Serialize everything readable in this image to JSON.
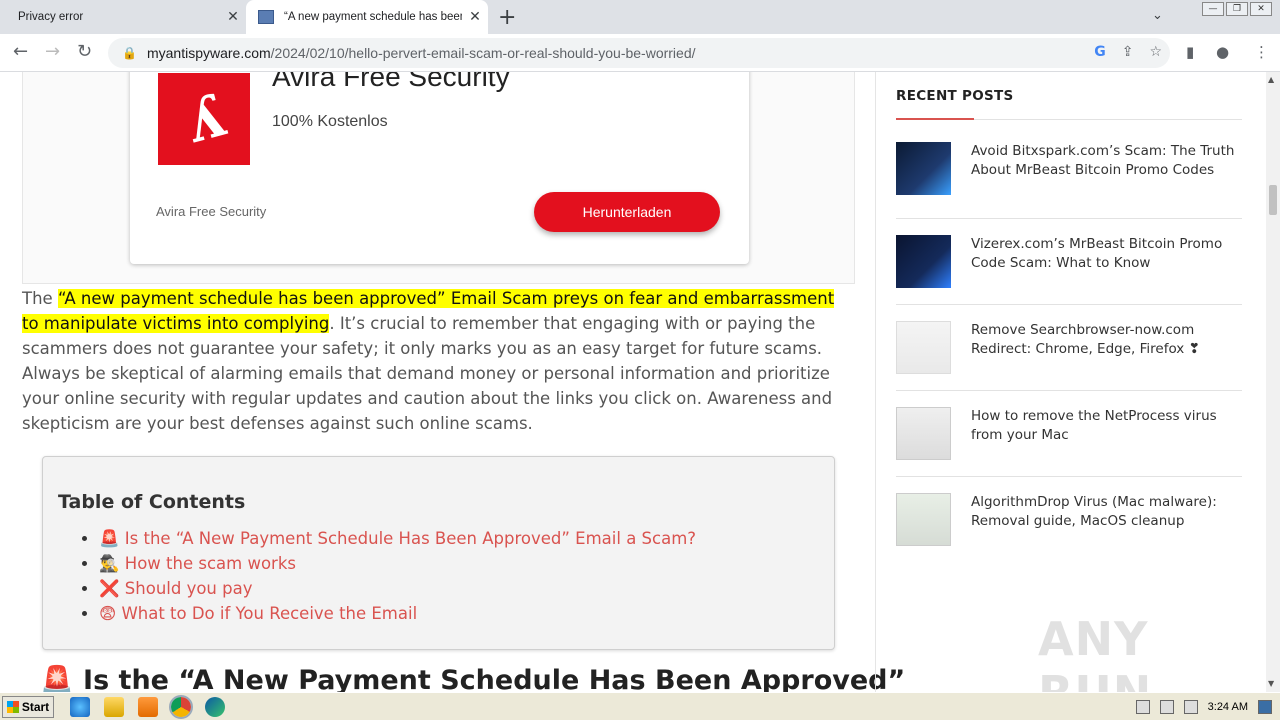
{
  "tabs": [
    {
      "title": "Privacy error",
      "active": false
    },
    {
      "title": "“A new payment schedule has been approved”",
      "active": true
    }
  ],
  "window_buttons": [
    "—",
    "❐",
    "✕"
  ],
  "address": {
    "domain": "myantispyware.com",
    "path": "/2024/02/10/hello-pervert-email-scam-or-real-should-you-be-worried/"
  },
  "ad": {
    "title": "Avira Free Security",
    "subtitle": "100% Kostenlos",
    "brand": "Avira Free Security",
    "button": "Herunterladen",
    "logo_color": "#e3101e"
  },
  "article": {
    "intro": "The ",
    "highlight": "“A new payment schedule has been approved” Email Scam preys on fear and embarrassment to manipulate victims into complying",
    "body": ". It’s crucial to remember that engaging with or paying the scammers does not guarantee your safety; it only marks you as an easy target for future scams. Always be skeptical of alarming emails that demand money or personal information and prioritize your online security with regular updates and caution about the links you click on. Awareness and skepticism are your best defenses against such online scams."
  },
  "toc": {
    "title": "Table of Contents",
    "items": [
      "🚨 Is the “A New Payment Schedule Has Been Approved” Email a Scam?",
      "🕵️‍♂️ How the scam works",
      "❌ Should you pay",
      "😨 What to Do if You Receive the Email"
    ]
  },
  "heading": "🚨 Is the “A New Payment Schedule Has Been Approved”",
  "sidebar": {
    "title": "RECENT POSTS",
    "accent": "#d9534f",
    "posts": [
      {
        "title": "Avoid Bitxspark.com’s Scam: The Truth About MrBeast Bitcoin Promo Codes"
      },
      {
        "title": "Vizerex.com’s MrBeast Bitcoin Promo Code Scam: What to Know"
      },
      {
        "title": "Remove Searchbrowser-now.com Redirect: Chrome, Edge, Firefox ❣"
      },
      {
        "title": "How to remove the NetProcess virus from your Mac"
      },
      {
        "title": "AlgorithmDrop Virus (Mac malware): Removal guide, MacOS cleanup"
      }
    ]
  },
  "watermark": "ANY RUN",
  "taskbar": {
    "start": "Start",
    "clock": "3:24 AM"
  }
}
